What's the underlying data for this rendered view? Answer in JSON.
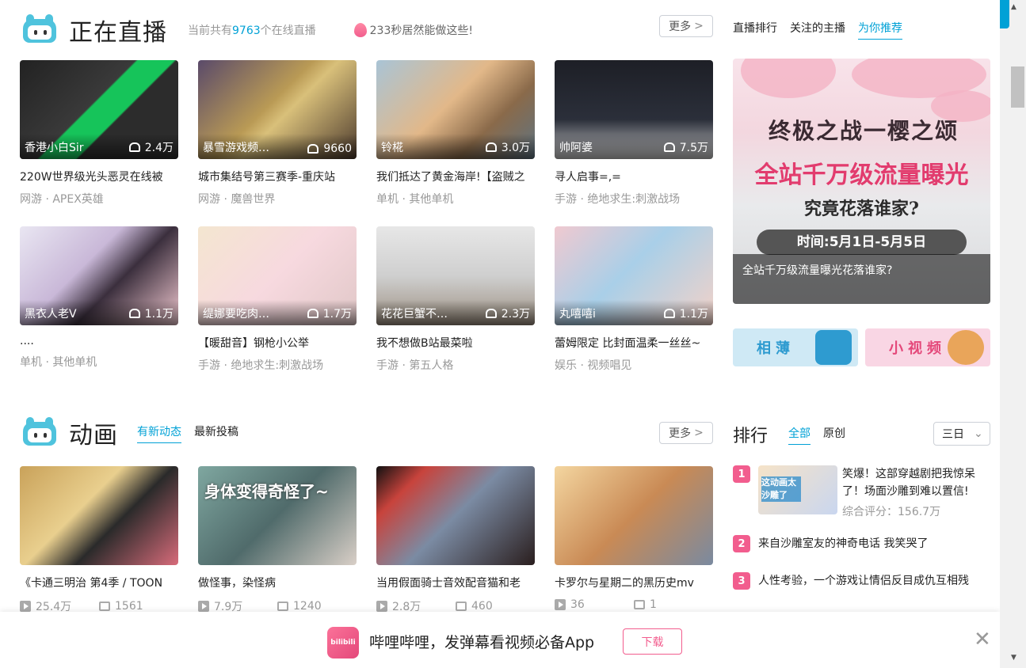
{
  "live": {
    "title": "正在直播",
    "online_prefix": "当前共有",
    "online_count": "9763",
    "online_suffix": "个在线直播",
    "hot_text": "233秒居然能做这些!",
    "more": "更多",
    "side_tabs": [
      "直播排行",
      "关注的主播",
      "为你推荐"
    ],
    "cards": [
      {
        "uname": "香港小白Sir",
        "viewers": "2.4万",
        "title": "220W世界级光头恶灵在线被",
        "meta": "网游 · APEX英雄",
        "bg": "linear-gradient(135deg,#222 0%,#3a3a3a 45%,#16c45a 46%,#16c45a 60%,#2c2c2c 61%)"
      },
      {
        "uname": "暴雪游戏频…",
        "viewers": "9660",
        "title": "城市集结号第三赛季-重庆站",
        "meta": "网游 · 魔兽世界",
        "bg": "linear-gradient(135deg,#5a4a6a 0%,#b99a55 45%,#d9c07a 55%,#4d3b2e 100%)"
      },
      {
        "uname": "铃椛",
        "viewers": "3.0万",
        "title": "我们抵达了黄金海岸!【盗贼之",
        "meta": "单机 · 其他单机",
        "bg": "linear-gradient(135deg,#a9c4d6 0%,#e2b889 45%,#8a6a4a 70%,#5f7482 100%)"
      },
      {
        "uname": "帅阿婆",
        "viewers": "7.5万",
        "title": "寻人启事=,=",
        "meta": "手游 · 绝地求生:刺激战场",
        "bg": "linear-gradient(180deg,#1d1f26 0%,#2b2f3a 60%,#cfcfcf 100%)"
      },
      {
        "uname": "黑衣人老V",
        "viewers": "1.1万",
        "title": "....",
        "meta": "单机 · 其他单机",
        "bg": "linear-gradient(135deg,#e9e6f2 0%,#c9b8d8 40%,#3b2f3d 60%,#f2c9d1 100%)"
      },
      {
        "uname": "缇娜要吃肉…",
        "viewers": "1.7万",
        "title": "【暖甜音】钢枪小公举",
        "meta": "手游 · 绝地求生:刺激战场",
        "bg": "linear-gradient(135deg,#f4e6d0 0%,#f7d9df 50%,#e0c7c7 100%)"
      },
      {
        "uname": "花花巨蟹不…",
        "viewers": "2.3万",
        "title": "我不想做B站最菜啦",
        "meta": "手游 · 第五人格",
        "bg": "linear-gradient(180deg,#e7e7e7 0%,#cfcfcf 50%,#9c8f80 100%)"
      },
      {
        "uname": "丸嘻嘻i",
        "viewers": "1.1万",
        "title": "蕾姆限定 比封面温柔一丝丝~",
        "meta": "娱乐 · 视频唱见",
        "bg": "linear-gradient(135deg,#f0c9d0 0%,#a9cfe8 45%,#f3d2c8 100%)"
      }
    ],
    "banner": {
      "line1": "终极之战一樱之颂",
      "line2": "全站千万级流量曝光",
      "line3": "究竟花落谁家?",
      "line4": "时间:5月1日-5月5日",
      "caption": "全站千万级流量曝光花落谁家?"
    },
    "mini_buttons": [
      "相薄",
      "小视频"
    ]
  },
  "anime": {
    "title": "动画",
    "tabs": [
      "有新动态",
      "最新投稿"
    ],
    "more": "更多",
    "cards": [
      {
        "title": "《卡通三明治 第4季 / TOON",
        "plays": "25.4万",
        "danmaku": "1561",
        "bg": "linear-gradient(135deg,#c9a25a 0%,#e9cf8e 40%,#2a2a2a 60%,#d86b7a 100%)"
      },
      {
        "title": "做怪事，染怪病",
        "plays": "7.9万",
        "danmaku": "1240",
        "bg": "linear-gradient(135deg,#7fa7a0 0%,#506b6b 50%,#d9cfc7 100%)"
      },
      {
        "title": "当用假面骑士音效配音猫和老",
        "plays": "2.8万",
        "danmaku": "460",
        "bg": "linear-gradient(135deg,#111 0%,#c8433c 20%,#7b8ba3 50%,#2a1e1e 100%)"
      },
      {
        "title": "卡罗尔与星期二的黑历史mv",
        "plays": "36",
        "danmaku": "1",
        "bg": "linear-gradient(135deg,#f4d6a0 0%,#c98a55 50%,#7a8aa0 100%)"
      }
    ],
    "overlay_texts": [
      "身体变得奇怪了~"
    ]
  },
  "ranking": {
    "title": "排行",
    "tabs": [
      "全部",
      "原创"
    ],
    "period": "三日",
    "items": [
      {
        "rank": "1",
        "title": "笑爆！这部穿越剧把我惊呆了！场面沙雕到难以置信!",
        "score": "综合评分：156.7万",
        "thumb_text": "这动画太沙雕了"
      },
      {
        "rank": "2",
        "title": "来自沙雕室友的神奇电话 我笑哭了"
      },
      {
        "rank": "3",
        "title": "人性考验，一个游戏让情侣反目成仇互相残"
      }
    ]
  },
  "app_bar": {
    "logo_text": "bilibili",
    "text": "哔哩哔哩，发弹幕看视频必备App",
    "download": "下载",
    "close": "✕"
  },
  "colors": {
    "accent": "#00a1d6",
    "pink": "#f25d8e"
  }
}
